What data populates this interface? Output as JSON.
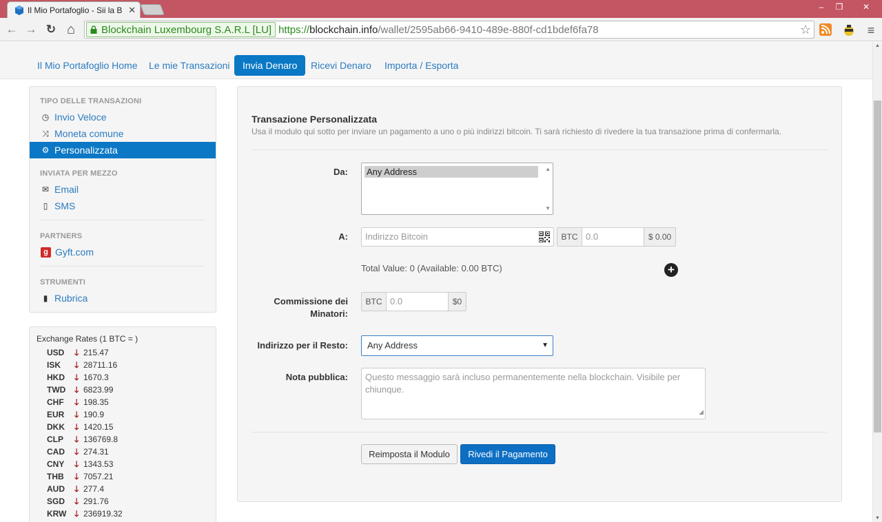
{
  "browser": {
    "tab_title": "Il Mio Portafoglio - Sii la B",
    "tab_close": "✕",
    "ev_label": "Blockchain Luxembourg S.A.R.L [LU]",
    "url_protocol": "https://",
    "url_host": "blockchain.info",
    "url_path": "/wallet/2595ab66-9410-489e-880f-cd1bdef6fa78",
    "star_glyph": "☆",
    "back_glyph": "←",
    "forward_glyph": "→",
    "reload_glyph": "↻",
    "home_glyph": "⌂",
    "menu_glyph": "≡",
    "minimize_glyph": "–",
    "maximize_glyph": "❐",
    "close_glyph": "✕",
    "colors": {
      "titlebar": "#c45563",
      "accent": "#0a78c5"
    }
  },
  "nav": {
    "tabs": [
      {
        "label": "Il Mio Portafoglio Home"
      },
      {
        "label": "Le mie Transazioni"
      },
      {
        "label": "Invia Denaro",
        "active": true
      },
      {
        "label": "Ricevi Denaro"
      },
      {
        "label": "Importa / Esporta"
      }
    ]
  },
  "sidebar": {
    "section_transaction_type": "TIPO DELLE TRANSAZIONI",
    "quick_send": "Invio Veloce",
    "shared_coin": "Moneta comune",
    "custom": "Personalizzata",
    "section_sent_via": "INVIATA PER MEZZO",
    "email": "Email",
    "sms": "SMS",
    "section_partners": "PARTNERS",
    "gyft_logo": "g",
    "gyft": "Gyft.com",
    "section_tools": "STRUMENTI",
    "address_book": "Rubrica",
    "icons": {
      "clock": "◷",
      "shuffle": "⤨",
      "gear": "⚙",
      "mail": "✉",
      "phone": "▯",
      "book": "▮"
    }
  },
  "exchange_rates": {
    "title": "Exchange Rates (1 BTC = )",
    "arrow": "🡓",
    "rates": [
      {
        "currency": "USD",
        "value": "215.47"
      },
      {
        "currency": "ISK",
        "value": "28711.16"
      },
      {
        "currency": "HKD",
        "value": "1670.3"
      },
      {
        "currency": "TWD",
        "value": "6823.99"
      },
      {
        "currency": "CHF",
        "value": "198.35"
      },
      {
        "currency": "EUR",
        "value": "190.9"
      },
      {
        "currency": "DKK",
        "value": "1420.15"
      },
      {
        "currency": "CLP",
        "value": "136769.8"
      },
      {
        "currency": "CAD",
        "value": "274.31"
      },
      {
        "currency": "CNY",
        "value": "1343.53"
      },
      {
        "currency": "THB",
        "value": "7057.21"
      },
      {
        "currency": "AUD",
        "value": "277.4"
      },
      {
        "currency": "SGD",
        "value": "291.76"
      },
      {
        "currency": "KRW",
        "value": "236919.32"
      }
    ]
  },
  "form": {
    "title": "Transazione Personalizzata",
    "description": "Usa il modulo qui sotto per inviare un pagamento a uno o più indirizzi bitcoin. Ti sarà richiesto di rivedere la tua transazione prima di confermarla.",
    "from_label": "Da:",
    "from_option": "Any Address",
    "to_label": "A:",
    "to_placeholder": "Indirizzo Bitcoin",
    "btc_label": "BTC",
    "amount_placeholder": "0.0",
    "usd_value": "$ 0.00",
    "total_value": "Total Value: 0 (Available: 0.00 BTC)",
    "add_recipient_glyph": "+",
    "fee_label_1": "Commissione dei",
    "fee_label_2": "Minatori:",
    "fee_btc_label": "BTC",
    "fee_placeholder": "0.0",
    "fee_usd": "$0",
    "change_label": "Indirizzo per il Resto:",
    "change_value": "Any Address",
    "note_label": "Nota pubblica:",
    "note_placeholder": "Questo messaggio sarà incluso permanentemente nella blockchain. Visibile per chiunque.",
    "reset_button": "Reimposta il Modulo",
    "review_button": "Rivedi il Pagamento"
  }
}
